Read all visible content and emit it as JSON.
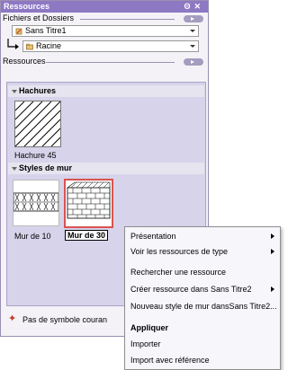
{
  "window": {
    "title": "Ressources",
    "controls": "ʘ ✕"
  },
  "files": {
    "label": "Fichiers et Dossiers",
    "file_dropdown": "Sans Titre1",
    "folder_dropdown": "Racine"
  },
  "resources": {
    "label": "Ressources",
    "categories": [
      {
        "name": "Hachures",
        "items": [
          "Hachure 45"
        ]
      },
      {
        "name": "Styles de mur",
        "items": [
          "Mur de 10",
          "Mur de 30"
        ]
      }
    ]
  },
  "status": {
    "text": "Pas de symbole courant"
  },
  "context_menu": {
    "items": [
      {
        "label": "Présentation",
        "submenu": true
      },
      {
        "label": "Voir les ressources de type",
        "submenu": true
      },
      {
        "label": "Rechercher une ressource",
        "submenu": false
      },
      {
        "label": "Créer ressource dans  Sans Titre2",
        "submenu": true
      },
      {
        "label": "Nouveau style de mur dansSans Titre2...",
        "submenu": false
      },
      {
        "label": "Appliquer",
        "submenu": false
      },
      {
        "label": "Importer",
        "submenu": false
      },
      {
        "label": "Import avec référence",
        "submenu": false
      }
    ]
  },
  "colors": {
    "titlebar": "#8d78c3",
    "panel": "#d7d3ea",
    "selection": "#d9534f"
  }
}
